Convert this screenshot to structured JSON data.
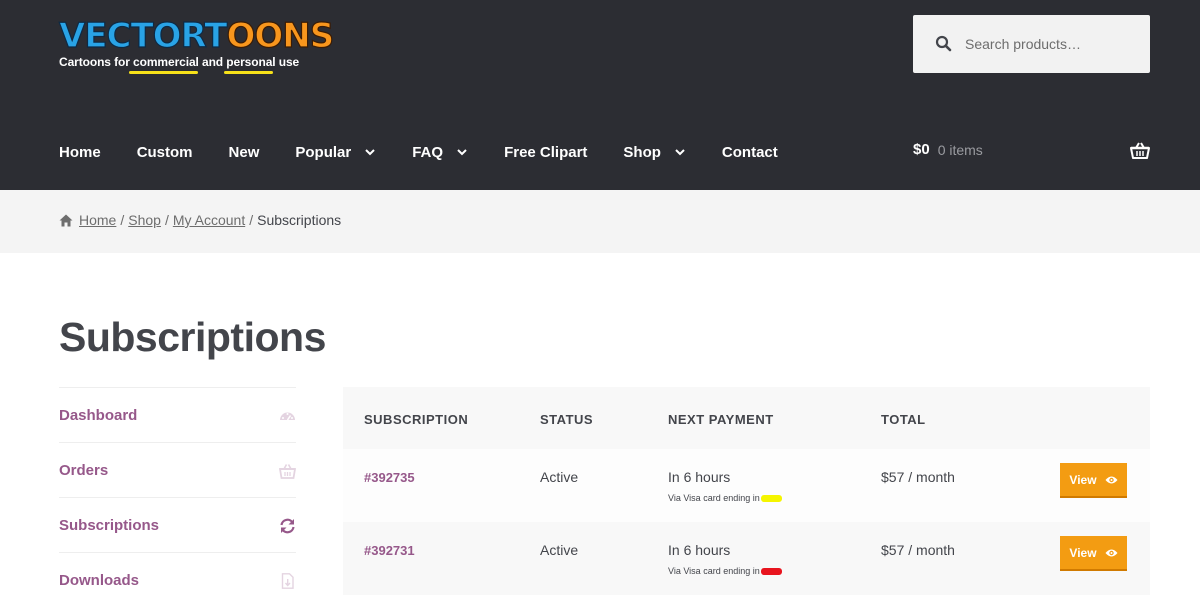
{
  "header": {
    "logo": {
      "word_part1": "VECTORT",
      "word_eyes": "OO",
      "word_part2": "NS",
      "tagline_pre": "Cartoons for ",
      "tagline_w1": "commercial",
      "tagline_mid": " and ",
      "tagline_w2": "personal",
      "tagline_post": " use"
    },
    "search": {
      "placeholder": "Search products…",
      "icon": "search-icon"
    },
    "nav": [
      {
        "label": "Home",
        "has_dropdown": false
      },
      {
        "label": "Custom",
        "has_dropdown": false
      },
      {
        "label": "New",
        "has_dropdown": false
      },
      {
        "label": "Popular",
        "has_dropdown": true
      },
      {
        "label": "FAQ",
        "has_dropdown": true
      },
      {
        "label": "Free Clipart",
        "has_dropdown": false
      },
      {
        "label": "Shop",
        "has_dropdown": true
      },
      {
        "label": "Contact",
        "has_dropdown": false
      }
    ],
    "cart": {
      "amount": "$0",
      "count": "0 items",
      "icon": "basket-icon"
    }
  },
  "breadcrumb": {
    "items": [
      "Home",
      "Shop",
      "My Account"
    ],
    "current": "Subscriptions",
    "separator": "/"
  },
  "page": {
    "title": "Subscriptions"
  },
  "account_nav": [
    {
      "label": "Dashboard",
      "icon": "dashboard-gauge-icon"
    },
    {
      "label": "Orders",
      "icon": "basket-icon"
    },
    {
      "label": "Subscriptions",
      "icon": "refresh-icon"
    },
    {
      "label": "Downloads",
      "icon": "file-download-icon"
    }
  ],
  "table": {
    "headers": [
      "SUBSCRIPTION",
      "STATUS",
      "NEXT PAYMENT",
      "TOTAL"
    ],
    "rows": [
      {
        "id": "#392735",
        "status": "Active",
        "next_payment": "In 6 hours",
        "note": "Via Visa card ending in",
        "redaction_color": "#f5f500",
        "total": "$57 / month",
        "action": "View"
      },
      {
        "id": "#392731",
        "status": "Active",
        "next_payment": "In 6 hours",
        "note": "Via Visa card ending in",
        "redaction_color": "#e8141e",
        "total": "$57 / month",
        "action": "View"
      }
    ]
  },
  "colors": {
    "header_bg": "#2c2d33",
    "link_purple": "#96588a",
    "button_orange": "#f39c12",
    "logo_blue": "#29a3e6",
    "logo_orange": "#f8961d"
  }
}
